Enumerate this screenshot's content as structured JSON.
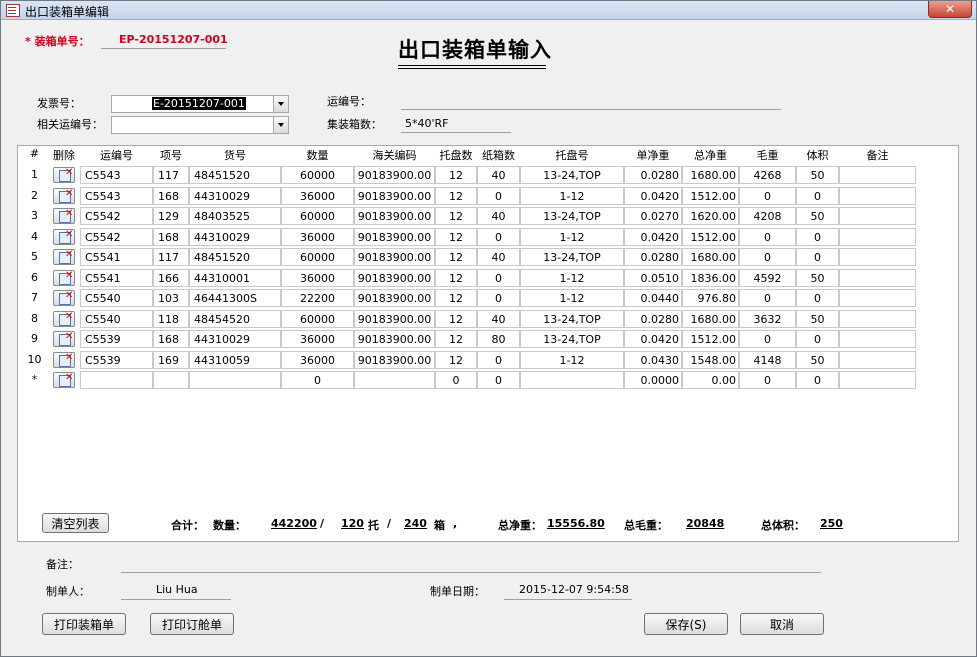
{
  "window": {
    "title": "出口装箱单编辑",
    "close_glyph": "✕"
  },
  "header": {
    "packing_no_label": "* 装箱单号：",
    "packing_no": "EP-20151207-001",
    "title": "出口装箱单输入"
  },
  "form": {
    "invoice_label": "发票号：",
    "invoice_value": "E-20151207-001",
    "related_label": "相关运编号：",
    "related_value": "",
    "shipping_label": "运编号：",
    "shipping_value": "",
    "container_label": "集装箱数：",
    "container_value": "5*40'RF"
  },
  "table": {
    "columns": [
      "#",
      "删除",
      "运编号",
      "项号",
      "货号",
      "数量",
      "海关编码",
      "托盘数",
      "纸箱数",
      "托盘号",
      "单净重",
      "总净重",
      "毛重",
      "体积",
      "备注"
    ],
    "rows": [
      [
        "1",
        "C5543",
        "117",
        "48451520",
        "60000",
        "90183900.00",
        "12",
        "40",
        "13-24,TOP",
        "0.0280",
        "1680.00",
        "4268",
        "50",
        ""
      ],
      [
        "2",
        "C5543",
        "168",
        "44310029",
        "36000",
        "90183900.00",
        "12",
        "0",
        "1-12",
        "0.0420",
        "1512.00",
        "0",
        "0",
        ""
      ],
      [
        "3",
        "C5542",
        "129",
        "48403525",
        "60000",
        "90183900.00",
        "12",
        "40",
        "13-24,TOP",
        "0.0270",
        "1620.00",
        "4208",
        "50",
        ""
      ],
      [
        "4",
        "C5542",
        "168",
        "44310029",
        "36000",
        "90183900.00",
        "12",
        "0",
        "1-12",
        "0.0420",
        "1512.00",
        "0",
        "0",
        ""
      ],
      [
        "5",
        "C5541",
        "117",
        "48451520",
        "60000",
        "90183900.00",
        "12",
        "40",
        "13-24,TOP",
        "0.0280",
        "1680.00",
        "0",
        "0",
        ""
      ],
      [
        "6",
        "C5541",
        "166",
        "44310001",
        "36000",
        "90183900.00",
        "12",
        "0",
        "1-12",
        "0.0510",
        "1836.00",
        "4592",
        "50",
        ""
      ],
      [
        "7",
        "C5540",
        "103",
        "46441300S",
        "22200",
        "90183900.00",
        "12",
        "0",
        "1-12",
        "0.0440",
        "976.80",
        "0",
        "0",
        ""
      ],
      [
        "8",
        "C5540",
        "118",
        "48454520",
        "60000",
        "90183900.00",
        "12",
        "40",
        "13-24,TOP",
        "0.0280",
        "1680.00",
        "3632",
        "50",
        ""
      ],
      [
        "9",
        "C5539",
        "168",
        "44310029",
        "36000",
        "90183900.00",
        "12",
        "80",
        "13-24,TOP",
        "0.0420",
        "1512.00",
        "0",
        "0",
        ""
      ],
      [
        "10",
        "C5539",
        "169",
        "44310059",
        "36000",
        "90183900.00",
        "12",
        "0",
        "1-12",
        "0.0430",
        "1548.00",
        "4148",
        "50",
        ""
      ],
      [
        "*",
        "",
        "",
        "",
        "0",
        "",
        "0",
        "0",
        "",
        "0.0000",
        "0.00",
        "0",
        "0",
        ""
      ]
    ]
  },
  "summary": {
    "clear_button": "清空列表",
    "total_label": "合计：",
    "qty_label": "数量：",
    "qty": "442200",
    "slash1": "/",
    "pallets": "120",
    "pallet_unit": "托",
    "slash2": "/",
    "cartons": "240",
    "carton_unit": "箱",
    "comma": ",",
    "net_label": "总净重：",
    "net": "15556.80",
    "gross_label": "总毛重：",
    "gross": "20848",
    "volume_label": "总体积：",
    "volume": "250"
  },
  "footer": {
    "remarks_label": "备注：",
    "maker_label": "制单人：",
    "maker": "Liu Hua",
    "date_label": "制单日期：",
    "date": "2015-12-07 9:54:58",
    "print_packing": "打印装箱单",
    "print_booking": "打印订舱单",
    "save": "保存(S)",
    "cancel": "取消"
  },
  "icons": {
    "delete_row": "delete-row-icon",
    "dropdown": "chevron-down-icon"
  }
}
